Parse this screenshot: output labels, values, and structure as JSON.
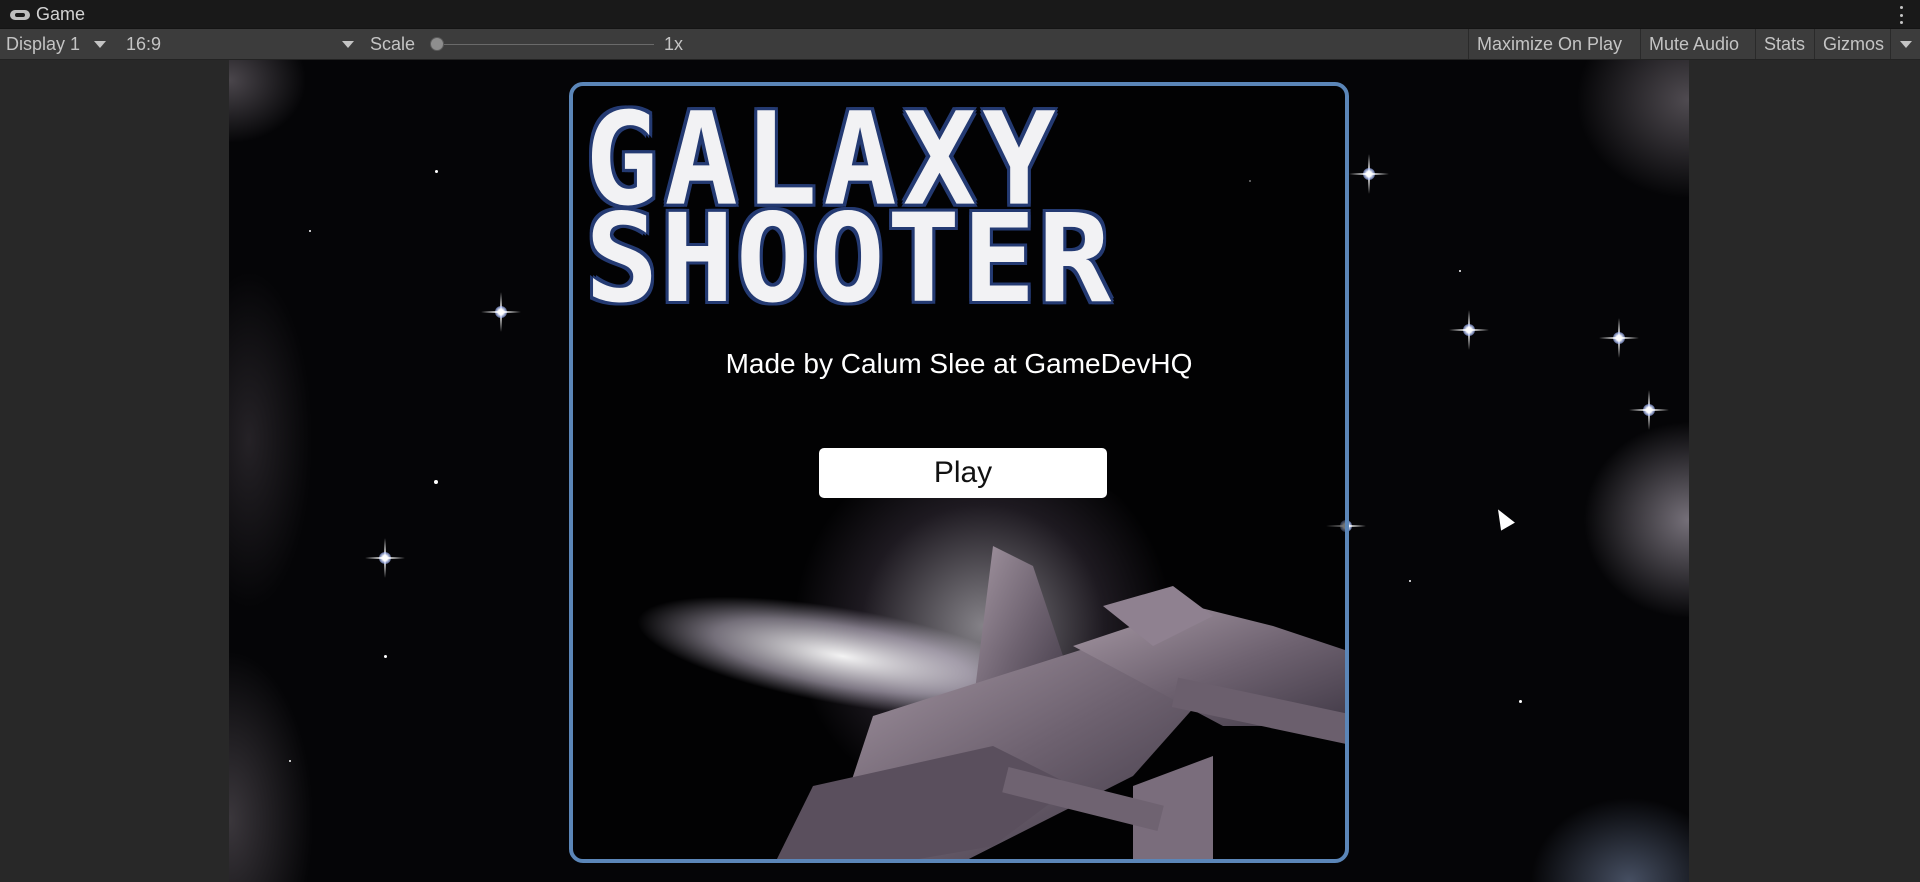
{
  "window": {
    "tab_title": "Game",
    "tab_icon": "gamepad-icon"
  },
  "toolbar": {
    "display": "Display 1",
    "aspect": "16:9",
    "scale_label": "Scale",
    "scale_value": "1x",
    "scale_fraction": 0.0,
    "maximize_on_play": "Maximize On Play",
    "mute_audio": "Mute Audio",
    "stats": "Stats",
    "gizmos": "Gizmos"
  },
  "game": {
    "title_line1": "GALAXY",
    "title_line2": "SHOOTER",
    "credit": "Made by Calum Slee at GameDevHQ",
    "play_button": "Play"
  },
  "colors": {
    "panel_border": "#5b86b8",
    "title_outline": "#243a72",
    "editor_bg": "#282828"
  }
}
